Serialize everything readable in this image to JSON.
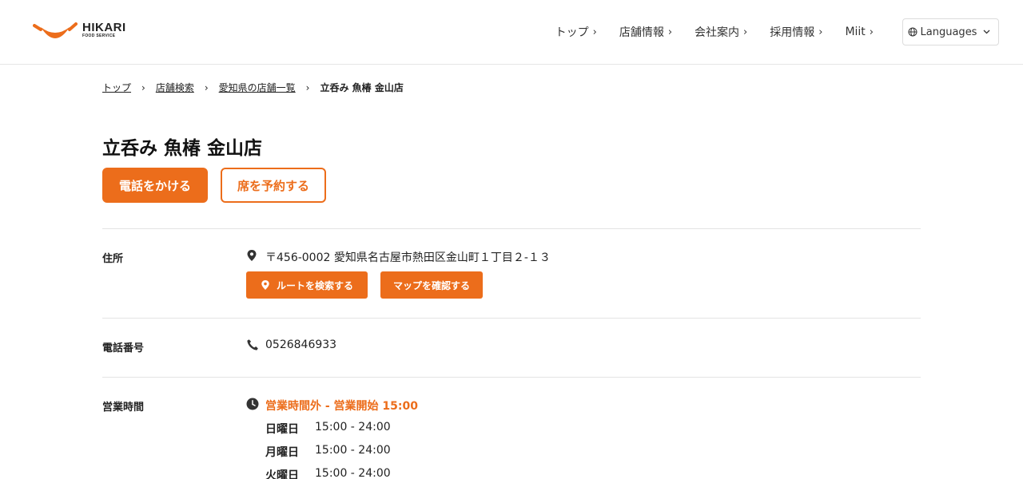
{
  "header": {
    "logo_main": "HIKARI",
    "logo_sub": "FOOD SERVICE",
    "nav": [
      {
        "label": "トップ"
      },
      {
        "label": "店舗情報"
      },
      {
        "label": "会社案内"
      },
      {
        "label": "採用情報"
      },
      {
        "label": "Miit"
      }
    ],
    "languages_label": "Languages"
  },
  "breadcrumb": {
    "items": [
      "トップ",
      "店舗検索",
      "愛知県の店舗一覧"
    ],
    "current": "立呑み 魚椿 金山店"
  },
  "store": {
    "title": "立呑み 魚椿 金山店",
    "call_button": "電話をかける",
    "reserve_button": "席を予約する",
    "address_label": "住所",
    "address": "〒456-0002 愛知県名古屋市熱田区金山町１丁目２-１３",
    "route_button": "ルートを検索する",
    "map_button": "マップを確認する",
    "phone_label": "電話番号",
    "phone": "0526846933",
    "hours_label": "営業時間",
    "hours_status": "営業時間外 - 営業開始 15:00",
    "hours": [
      {
        "day": "日曜日",
        "time": "15:00 - 24:00"
      },
      {
        "day": "月曜日",
        "time": "15:00 - 24:00"
      },
      {
        "day": "火曜日",
        "time": "15:00 - 24:00"
      }
    ]
  },
  "colors": {
    "accent": "#ec6d1b",
    "text": "#222222",
    "divider": "#e3e3e3"
  },
  "icons": {
    "logo": "smile-bowl-icon",
    "chevron": "chevron-right-icon",
    "globe": "globe-icon",
    "chevron_down": "chevron-down-icon",
    "location": "location-pin-icon",
    "phone": "phone-icon",
    "clock": "clock-icon"
  }
}
